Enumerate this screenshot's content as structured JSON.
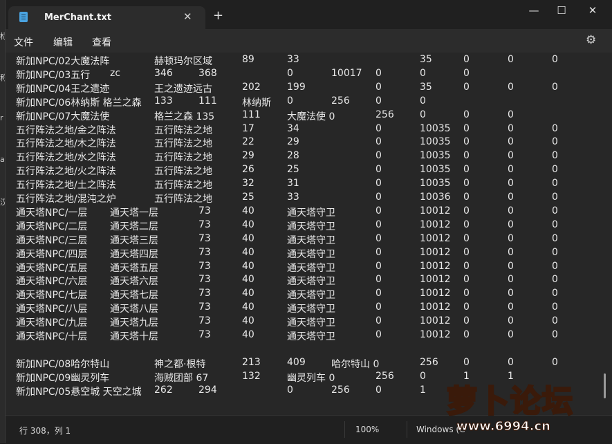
{
  "app": {
    "tab_title": "MerChant.txt",
    "close_glyph": "✕",
    "newtab_glyph": "+",
    "minimize_glyph": "—",
    "maximize_glyph": "☐",
    "window_close_glyph": "✕",
    "gear_glyph": "⚙",
    "accent_color": "#4aa3e0"
  },
  "menu": {
    "file": "文件",
    "edit": "编辑",
    "view": "查看"
  },
  "desktop_strip": [
    "标",
    "称",
    "r",
    "a",
    "汉"
  ],
  "lines": [
    [
      {
        "c": 0,
        "t": "新加NPC/02大魔法阵"
      },
      {
        "c": 200,
        "t": "赫顿玛尔区域"
      },
      {
        "c": 327,
        "t": "89"
      },
      {
        "c": 392,
        "t": "33"
      },
      {
        "c": 584,
        "t": "35"
      },
      {
        "c": 647,
        "t": "0"
      },
      {
        "c": 711,
        "t": "0"
      },
      {
        "c": 775,
        "t": "0"
      }
    ],
    [
      {
        "c": 0,
        "t": "新加NPC/03五行"
      },
      {
        "c": 136,
        "t": "zc"
      },
      {
        "c": 200,
        "t": "346"
      },
      {
        "c": 264,
        "t": "368"
      },
      {
        "c": 392,
        "t": "0"
      },
      {
        "c": 456,
        "t": "10017"
      },
      {
        "c": 520,
        "t": "0"
      },
      {
        "c": 584,
        "t": "0"
      },
      {
        "c": 647,
        "t": "0"
      }
    ],
    [
      {
        "c": 0,
        "t": "新加NPC/04王之遗迹"
      },
      {
        "c": 200,
        "t": "王之遗迹远古"
      },
      {
        "c": 327,
        "t": "202"
      },
      {
        "c": 392,
        "t": "199"
      },
      {
        "c": 520,
        "t": "0"
      },
      {
        "c": 584,
        "t": "35"
      },
      {
        "c": 647,
        "t": "0"
      },
      {
        "c": 711,
        "t": "0"
      },
      {
        "c": 775,
        "t": "0"
      }
    ],
    [
      {
        "c": 0,
        "t": "新加NPC/06林纳斯 格兰之森"
      },
      {
        "c": 200,
        "t": "133"
      },
      {
        "c": 264,
        "t": "111"
      },
      {
        "c": 327,
        "t": "林纳斯"
      },
      {
        "c": 392,
        "t": "0"
      },
      {
        "c": 456,
        "t": "256"
      },
      {
        "c": 520,
        "t": "0"
      },
      {
        "c": 584,
        "t": "0"
      }
    ],
    [
      {
        "c": 0,
        "t": "新加NPC/07大魔法使"
      },
      {
        "c": 200,
        "t": "格兰之森 135"
      },
      {
        "c": 327,
        "t": "111"
      },
      {
        "c": 392,
        "t": "大魔法使 0"
      },
      {
        "c": 520,
        "t": "256"
      },
      {
        "c": 584,
        "t": "0"
      },
      {
        "c": 647,
        "t": "0"
      },
      {
        "c": 711,
        "t": "0"
      }
    ],
    [
      {
        "c": 0,
        "t": "五行阵法之地/金之阵法"
      },
      {
        "c": 200,
        "t": "五行阵法之地"
      },
      {
        "c": 327,
        "t": "17"
      },
      {
        "c": 392,
        "t": "34"
      },
      {
        "c": 520,
        "t": "0"
      },
      {
        "c": 584,
        "t": "10035"
      },
      {
        "c": 647,
        "t": "0"
      },
      {
        "c": 711,
        "t": "0"
      },
      {
        "c": 775,
        "t": "0"
      }
    ],
    [
      {
        "c": 0,
        "t": "五行阵法之地/木之阵法"
      },
      {
        "c": 200,
        "t": "五行阵法之地"
      },
      {
        "c": 327,
        "t": "22"
      },
      {
        "c": 392,
        "t": "29"
      },
      {
        "c": 520,
        "t": "0"
      },
      {
        "c": 584,
        "t": "10035"
      },
      {
        "c": 647,
        "t": "0"
      },
      {
        "c": 711,
        "t": "0"
      },
      {
        "c": 775,
        "t": "0"
      }
    ],
    [
      {
        "c": 0,
        "t": "五行阵法之地/水之阵法"
      },
      {
        "c": 200,
        "t": "五行阵法之地"
      },
      {
        "c": 327,
        "t": "29"
      },
      {
        "c": 392,
        "t": "28"
      },
      {
        "c": 520,
        "t": "0"
      },
      {
        "c": 584,
        "t": "10035"
      },
      {
        "c": 647,
        "t": "0"
      },
      {
        "c": 711,
        "t": "0"
      },
      {
        "c": 775,
        "t": "0"
      }
    ],
    [
      {
        "c": 0,
        "t": "五行阵法之地/火之阵法"
      },
      {
        "c": 200,
        "t": "五行阵法之地"
      },
      {
        "c": 327,
        "t": "26"
      },
      {
        "c": 392,
        "t": "25"
      },
      {
        "c": 520,
        "t": "0"
      },
      {
        "c": 584,
        "t": "10035"
      },
      {
        "c": 647,
        "t": "0"
      },
      {
        "c": 711,
        "t": "0"
      },
      {
        "c": 775,
        "t": "0"
      }
    ],
    [
      {
        "c": 0,
        "t": "五行阵法之地/土之阵法"
      },
      {
        "c": 200,
        "t": "五行阵法之地"
      },
      {
        "c": 327,
        "t": "32"
      },
      {
        "c": 392,
        "t": "31"
      },
      {
        "c": 520,
        "t": "0"
      },
      {
        "c": 584,
        "t": "10035"
      },
      {
        "c": 647,
        "t": "0"
      },
      {
        "c": 711,
        "t": "0"
      },
      {
        "c": 775,
        "t": "0"
      }
    ],
    [
      {
        "c": 0,
        "t": "五行阵法之地/混沌之炉"
      },
      {
        "c": 200,
        "t": "五行阵法之地"
      },
      {
        "c": 327,
        "t": "25"
      },
      {
        "c": 392,
        "t": "33"
      },
      {
        "c": 520,
        "t": "0"
      },
      {
        "c": 584,
        "t": "10036"
      },
      {
        "c": 647,
        "t": "0"
      },
      {
        "c": 711,
        "t": "0"
      },
      {
        "c": 775,
        "t": "0"
      }
    ],
    [
      {
        "c": 0,
        "t": "通天塔NPC/一层"
      },
      {
        "c": 136,
        "t": "通天塔一层"
      },
      {
        "c": 264,
        "t": "73"
      },
      {
        "c": 327,
        "t": "40"
      },
      {
        "c": 392,
        "t": "通天塔守卫"
      },
      {
        "c": 520,
        "t": "0"
      },
      {
        "c": 584,
        "t": "10012"
      },
      {
        "c": 647,
        "t": "0"
      },
      {
        "c": 711,
        "t": "0"
      },
      {
        "c": 775,
        "t": "0"
      }
    ],
    [
      {
        "c": 0,
        "t": "通天塔NPC/二层"
      },
      {
        "c": 136,
        "t": "通天塔二层"
      },
      {
        "c": 264,
        "t": "73"
      },
      {
        "c": 327,
        "t": "40"
      },
      {
        "c": 392,
        "t": "通天塔守卫"
      },
      {
        "c": 520,
        "t": "0"
      },
      {
        "c": 584,
        "t": "10012"
      },
      {
        "c": 647,
        "t": "0"
      },
      {
        "c": 711,
        "t": "0"
      },
      {
        "c": 775,
        "t": "0"
      }
    ],
    [
      {
        "c": 0,
        "t": "通天塔NPC/三层"
      },
      {
        "c": 136,
        "t": "通天塔三层"
      },
      {
        "c": 264,
        "t": "73"
      },
      {
        "c": 327,
        "t": "40"
      },
      {
        "c": 392,
        "t": "通天塔守卫"
      },
      {
        "c": 520,
        "t": "0"
      },
      {
        "c": 584,
        "t": "10012"
      },
      {
        "c": 647,
        "t": "0"
      },
      {
        "c": 711,
        "t": "0"
      },
      {
        "c": 775,
        "t": "0"
      }
    ],
    [
      {
        "c": 0,
        "t": "通天塔NPC/四层"
      },
      {
        "c": 136,
        "t": "通天塔四层"
      },
      {
        "c": 264,
        "t": "73"
      },
      {
        "c": 327,
        "t": "40"
      },
      {
        "c": 392,
        "t": "通天塔守卫"
      },
      {
        "c": 520,
        "t": "0"
      },
      {
        "c": 584,
        "t": "10012"
      },
      {
        "c": 647,
        "t": "0"
      },
      {
        "c": 711,
        "t": "0"
      },
      {
        "c": 775,
        "t": "0"
      }
    ],
    [
      {
        "c": 0,
        "t": "通天塔NPC/五层"
      },
      {
        "c": 136,
        "t": "通天塔五层"
      },
      {
        "c": 264,
        "t": "73"
      },
      {
        "c": 327,
        "t": "40"
      },
      {
        "c": 392,
        "t": "通天塔守卫"
      },
      {
        "c": 520,
        "t": "0"
      },
      {
        "c": 584,
        "t": "10012"
      },
      {
        "c": 647,
        "t": "0"
      },
      {
        "c": 711,
        "t": "0"
      },
      {
        "c": 775,
        "t": "0"
      }
    ],
    [
      {
        "c": 0,
        "t": "通天塔NPC/六层"
      },
      {
        "c": 136,
        "t": "通天塔六层"
      },
      {
        "c": 264,
        "t": "73"
      },
      {
        "c": 327,
        "t": "40"
      },
      {
        "c": 392,
        "t": "通天塔守卫"
      },
      {
        "c": 520,
        "t": "0"
      },
      {
        "c": 584,
        "t": "10012"
      },
      {
        "c": 647,
        "t": "0"
      },
      {
        "c": 711,
        "t": "0"
      },
      {
        "c": 775,
        "t": "0"
      }
    ],
    [
      {
        "c": 0,
        "t": "通天塔NPC/七层"
      },
      {
        "c": 136,
        "t": "通天塔七层"
      },
      {
        "c": 264,
        "t": "73"
      },
      {
        "c": 327,
        "t": "40"
      },
      {
        "c": 392,
        "t": "通天塔守卫"
      },
      {
        "c": 520,
        "t": "0"
      },
      {
        "c": 584,
        "t": "10012"
      },
      {
        "c": 647,
        "t": "0"
      },
      {
        "c": 711,
        "t": "0"
      },
      {
        "c": 775,
        "t": "0"
      }
    ],
    [
      {
        "c": 0,
        "t": "通天塔NPC/八层"
      },
      {
        "c": 136,
        "t": "通天塔八层"
      },
      {
        "c": 264,
        "t": "73"
      },
      {
        "c": 327,
        "t": "40"
      },
      {
        "c": 392,
        "t": "通天塔守卫"
      },
      {
        "c": 520,
        "t": "0"
      },
      {
        "c": 584,
        "t": "10012"
      },
      {
        "c": 647,
        "t": "0"
      },
      {
        "c": 711,
        "t": "0"
      },
      {
        "c": 775,
        "t": "0"
      }
    ],
    [
      {
        "c": 0,
        "t": "通天塔NPC/九层"
      },
      {
        "c": 136,
        "t": "通天塔九层"
      },
      {
        "c": 264,
        "t": "73"
      },
      {
        "c": 327,
        "t": "40"
      },
      {
        "c": 392,
        "t": "通天塔守卫"
      },
      {
        "c": 520,
        "t": "0"
      },
      {
        "c": 584,
        "t": "10012"
      },
      {
        "c": 647,
        "t": "0"
      },
      {
        "c": 711,
        "t": "0"
      },
      {
        "c": 775,
        "t": "0"
      }
    ],
    [
      {
        "c": 0,
        "t": "通天塔NPC/十层"
      },
      {
        "c": 136,
        "t": "通天塔十层"
      },
      {
        "c": 264,
        "t": "73"
      },
      {
        "c": 327,
        "t": "40"
      },
      {
        "c": 392,
        "t": "通天塔守卫"
      },
      {
        "c": 520,
        "t": "0"
      },
      {
        "c": 584,
        "t": "10012"
      },
      {
        "c": 647,
        "t": "0"
      },
      {
        "c": 711,
        "t": "0"
      },
      {
        "c": 775,
        "t": "0"
      }
    ],
    [],
    [
      {
        "c": 0,
        "t": "新加NPC/08哈尔特山"
      },
      {
        "c": 200,
        "t": "神之都·根特"
      },
      {
        "c": 327,
        "t": "213"
      },
      {
        "c": 392,
        "t": "409"
      },
      {
        "c": 456,
        "t": "哈尔特山 0"
      },
      {
        "c": 584,
        "t": "256"
      },
      {
        "c": 647,
        "t": "0"
      },
      {
        "c": 711,
        "t": "0"
      },
      {
        "c": 775,
        "t": "0"
      }
    ],
    [
      {
        "c": 0,
        "t": "新加NPC/09幽灵列车"
      },
      {
        "c": 200,
        "t": "海贼团部 67"
      },
      {
        "c": 327,
        "t": "132"
      },
      {
        "c": 392,
        "t": "幽灵列车 0"
      },
      {
        "c": 520,
        "t": "256"
      },
      {
        "c": 584,
        "t": "0"
      },
      {
        "c": 647,
        "t": "1"
      },
      {
        "c": 711,
        "t": "1"
      }
    ],
    [
      {
        "c": 0,
        "t": "新加NPC/05悬空城 天空之城"
      },
      {
        "c": 200,
        "t": "262"
      },
      {
        "c": 264,
        "t": "294"
      },
      {
        "c": 392,
        "t": "0"
      },
      {
        "c": 456,
        "t": "256"
      },
      {
        "c": 520,
        "t": "0"
      },
      {
        "c": 584,
        "t": "1"
      }
    ]
  ],
  "status": {
    "position": "行 308，列 1",
    "zoom": "100%",
    "line_ending": "Windows (C"
  },
  "watermark": {
    "title": "萝卜论坛",
    "site": "www.6994.cn"
  }
}
